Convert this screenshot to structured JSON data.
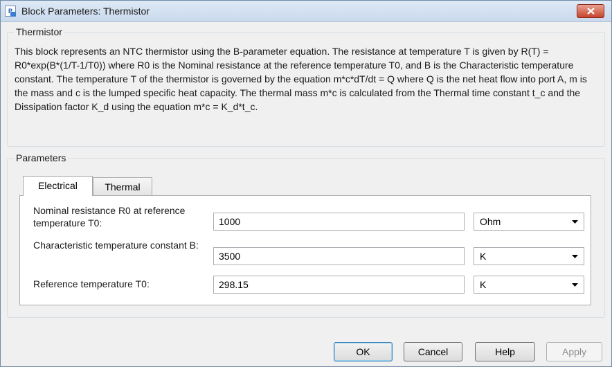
{
  "window": {
    "title": "Block Parameters: Thermistor"
  },
  "block": {
    "name": "Thermistor",
    "description": "This block represents an NTC thermistor using the B-parameter equation. The resistance at temperature T is given by R(T) = R0*exp(B*(1/T-1/T0)) where R0 is the Nominal resistance at the reference temperature T0, and B is the Characteristic temperature constant. The temperature T of the thermistor is governed by the equation m*c*dT/dt = Q where Q is the net heat flow into port A, m is the mass and c is the lumped specific heat capacity. The thermal mass m*c is calculated from the Thermal time constant t_c and the Dissipation factor K_d using the equation m*c = K_d*t_c."
  },
  "parameters": {
    "label": "Parameters",
    "tabs": [
      {
        "label": "Electrical",
        "active": true
      },
      {
        "label": "Thermal",
        "active": false
      }
    ],
    "rows": [
      {
        "label": "Nominal resistance R0 at reference temperature T0:",
        "value": "1000",
        "unit": "Ohm"
      },
      {
        "label": "Characteristic temperature constant B:",
        "value": "3500",
        "unit": "K"
      },
      {
        "label": "Reference temperature T0:",
        "value": "298.15",
        "unit": "K"
      }
    ]
  },
  "buttons": {
    "ok": "OK",
    "cancel": "Cancel",
    "help": "Help",
    "apply": "Apply"
  }
}
